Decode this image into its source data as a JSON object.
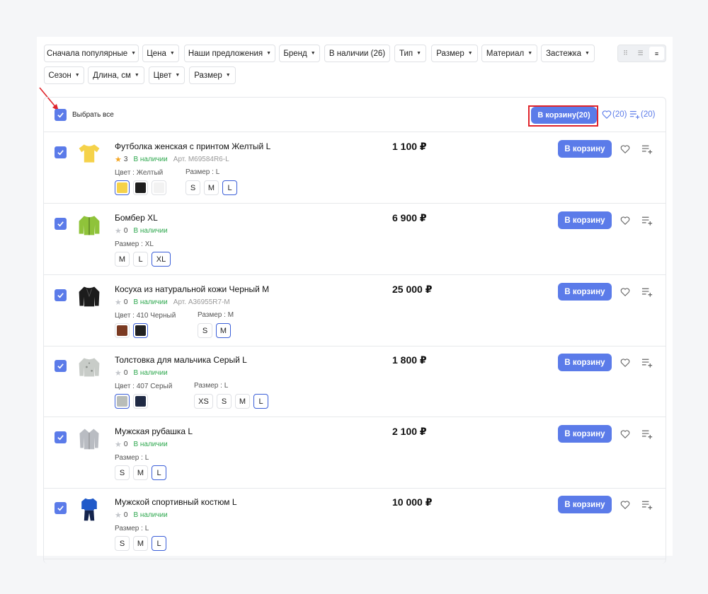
{
  "filters": {
    "row1": [
      {
        "label": "Сначала популярные",
        "name": "filter-sort"
      },
      {
        "label": "Цена",
        "name": "filter-price"
      },
      {
        "label": "Наши предложения",
        "name": "filter-offers"
      },
      {
        "label": "Бренд",
        "name": "filter-brand"
      },
      {
        "label": "В наличии (26)",
        "name": "filter-in-stock"
      },
      {
        "label": "Тип",
        "name": "filter-type"
      },
      {
        "label": "Размер",
        "name": "filter-size"
      },
      {
        "label": "Материал",
        "name": "filter-material"
      },
      {
        "label": "Застежка",
        "name": "filter-fastener"
      }
    ],
    "row2": [
      {
        "label": "Сезон",
        "name": "filter-season"
      },
      {
        "label": "Длина, см",
        "name": "filter-length"
      },
      {
        "label": "Цвет",
        "name": "filter-color"
      },
      {
        "label": "Размер",
        "name": "filter-size-2"
      }
    ]
  },
  "view_modes": [
    "grid-large-icon",
    "grid-list-icon",
    "list-icon"
  ],
  "select_all": {
    "label": "Выбрать все",
    "checked": true
  },
  "bulk": {
    "cart_label": "В корзину",
    "cart_count": "(20)",
    "fav_count": "(20)",
    "compare_count": "(20)"
  },
  "product_labels": {
    "cart": "В корзину",
    "color_prefix": "Цвет : ",
    "size_prefix": "Размер : "
  },
  "products": [
    {
      "name": "Футболка женская с принтом Желтый L",
      "rating": "3",
      "rated": true,
      "stock": "В наличии",
      "sku": "Арт. M69584R6-L",
      "price": "1 100 ₽",
      "color_label": "Цвет : Желтый",
      "size_label": "Размер : L",
      "colors": [
        "#f5d24a",
        "#1e1e1e",
        "#f2f2f2"
      ],
      "color_selected": 0,
      "sizes": [
        "S",
        "M",
        "L"
      ],
      "size_selected": 2,
      "thumb": "tshirt-yellow"
    },
    {
      "name": "Бомбер XL",
      "rating": "0",
      "rated": false,
      "stock": "В наличии",
      "sku": "",
      "price": "6 900 ₽",
      "color_label": "",
      "size_label": "Размер : XL",
      "colors": [],
      "color_selected": -1,
      "sizes": [
        "M",
        "L",
        "XL"
      ],
      "size_selected": 2,
      "thumb": "bomber-green"
    },
    {
      "name": "Косуха из натуральной кожи Черный M",
      "rating": "0",
      "rated": false,
      "stock": "В наличии",
      "sku": "Арт. A36955R7-M",
      "price": "25 000 ₽",
      "color_label": "Цвет : 410 Черный",
      "size_label": "Размер : M",
      "colors": [
        "#7a3a22",
        "#222222"
      ],
      "color_selected": 1,
      "sizes": [
        "S",
        "M"
      ],
      "size_selected": 1,
      "thumb": "leather-jacket"
    },
    {
      "name": "Толстовка для мальчика Серый L",
      "rating": "0",
      "rated": false,
      "stock": "В наличии",
      "sku": "",
      "price": "1 800 ₽",
      "color_label": "Цвет : 407 Серый",
      "size_label": "Размер : L",
      "colors": [
        "#b9bdb9",
        "#1f2a44"
      ],
      "color_selected": 0,
      "sizes": [
        "XS",
        "S",
        "M",
        "L"
      ],
      "size_selected": 3,
      "thumb": "sweatshirt-grey"
    },
    {
      "name": "Мужская рубашка L",
      "rating": "0",
      "rated": false,
      "stock": "В наличии",
      "sku": "",
      "price": "2 100 ₽",
      "color_label": "",
      "size_label": "Размер : L",
      "colors": [],
      "color_selected": -1,
      "sizes": [
        "S",
        "M",
        "L"
      ],
      "size_selected": 2,
      "thumb": "shirt-grey"
    },
    {
      "name": "Мужской спортивный костюм L",
      "rating": "0",
      "rated": false,
      "stock": "В наличии",
      "sku": "",
      "price": "10 000 ₽",
      "color_label": "",
      "size_label": "Размер : L",
      "colors": [],
      "color_selected": -1,
      "sizes": [
        "S",
        "M",
        "L"
      ],
      "size_selected": 2,
      "thumb": "tracksuit-blue"
    }
  ],
  "colors": {
    "accent": "#5b7be9",
    "stock_green": "#2fa84f",
    "star_gold": "#f4a623",
    "highlight_red": "#e0242b"
  }
}
